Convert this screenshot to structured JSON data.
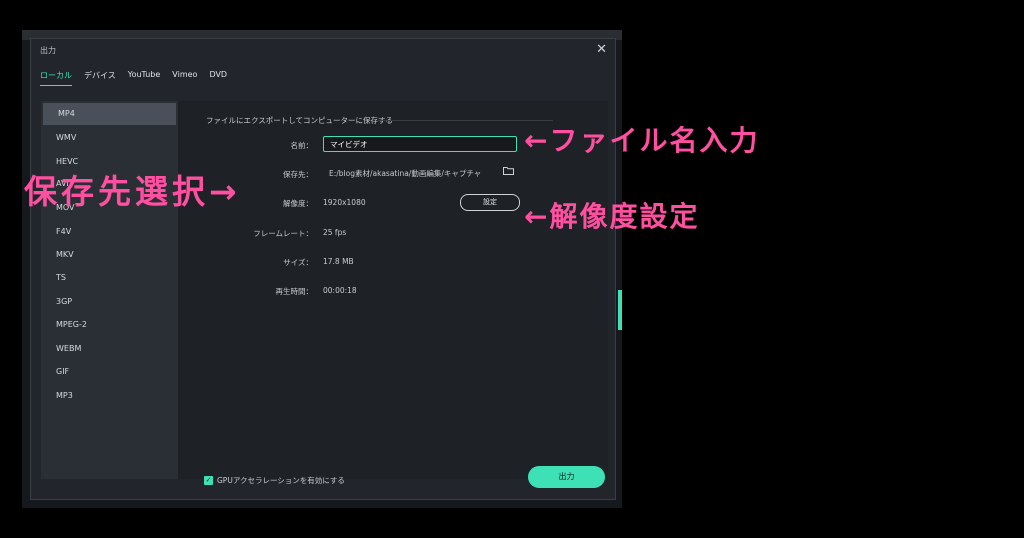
{
  "dialog": {
    "title": "出力",
    "close_glyph": "✕",
    "tabs": [
      {
        "label": "ローカル",
        "active": true
      },
      {
        "label": "デバイス"
      },
      {
        "label": "YouTube"
      },
      {
        "label": "Vimeo"
      },
      {
        "label": "DVD"
      }
    ],
    "formats": [
      "MP4",
      "WMV",
      "HEVC",
      "AVI",
      "MOV",
      "F4V",
      "MKV",
      "TS",
      "3GP",
      "MPEG-2",
      "WEBM",
      "GIF",
      "MP3"
    ],
    "selected_format": "MP4",
    "section_title": "ファイルにエクスポートしてコンピューターに保存する",
    "fields": {
      "name_label": "名前：",
      "name_value": "マイビデオ",
      "save_label": "保存先：",
      "save_value": "E:/blog素材/akasatina/動画編集/キャプチャ",
      "folder_icon": "folder-icon",
      "resolution_label": "解像度：",
      "resolution_value": "1920x1080",
      "settings_button": "設定",
      "framerate_label": "フレームレート：",
      "framerate_value": "25 fps",
      "size_label": "サイズ：",
      "size_value": "17.8 MB",
      "duration_label": "再生時間：",
      "duration_value": "00:00:18"
    },
    "gpu_checkbox": {
      "label": "GPUアクセラレーションを有効にする",
      "checked": true,
      "check_glyph": "✓"
    },
    "export_button": "出力",
    "accent_color": "#3ee0b6"
  },
  "annotations": {
    "filename": "←ファイル名入力",
    "savepath": "保存先選択→",
    "resolution": "←解像度設定",
    "color": "#ff4fa0"
  }
}
